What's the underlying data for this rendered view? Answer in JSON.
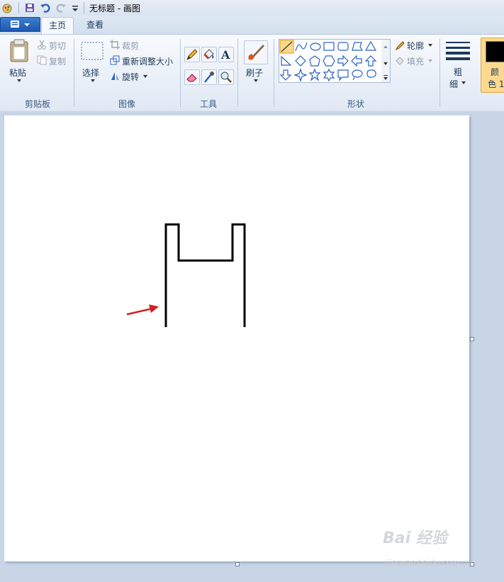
{
  "window": {
    "title": "无标题 - 画图"
  },
  "tabs": [
    {
      "label": "主页"
    },
    {
      "label": "查看"
    }
  ],
  "ribbon": {
    "clipboard": {
      "paste": "粘贴",
      "cut": "剪切",
      "copy": "复制",
      "group": "剪贴板"
    },
    "image": {
      "select": "选择",
      "crop": "裁剪",
      "resize": "重新调整大小",
      "rotate": "旋转",
      "group": "图像"
    },
    "tools": {
      "group": "工具",
      "text_glyph": "A"
    },
    "brushes": {
      "label": "刷子"
    },
    "shapes": {
      "outline": "轮廓",
      "fill": "填充",
      "group": "形状"
    },
    "size": {
      "line1": "粗",
      "line2": "细"
    },
    "colors": {
      "line1": "颜",
      "line2": "色 1"
    }
  },
  "watermark": {
    "text": "Bai 经验",
    "sub": "jingyan.baidu.com"
  },
  "colors": {
    "accent": "#1c57b1",
    "arrow": "#d42020",
    "stroke": "#000000"
  }
}
